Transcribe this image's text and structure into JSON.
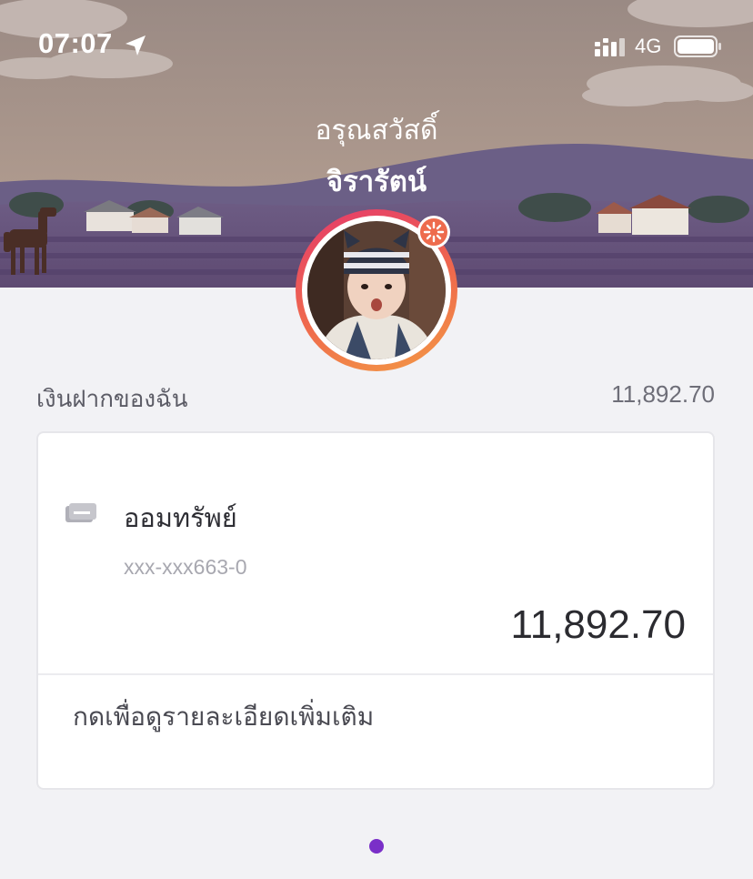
{
  "status_bar": {
    "time": "07:07",
    "network": "4G",
    "icons": [
      "location-arrow-icon",
      "signal-icon",
      "battery-icon"
    ]
  },
  "header": {
    "greeting": "อรุณสวัสดิ์",
    "user_name": "จิรารัตน์"
  },
  "deposits": {
    "label": "เงินฝากของฉัน",
    "total": "11,892.70"
  },
  "account_card": {
    "icon": "bankbook-icon",
    "account_type": "ออมทรัพย์",
    "account_number": "xxx-xxx663-0",
    "balance": "11,892.70",
    "details_link": "กดเพื่อดูรายละเอียดเพิ่มเติม"
  },
  "pagination": {
    "total_dots": 1,
    "active_index": 0
  },
  "colors": {
    "accent_purple": "#7a2fc8",
    "avatar_ring_start": "#e53a6b",
    "avatar_ring_end": "#f39a45",
    "background": "#f2f2f5"
  }
}
